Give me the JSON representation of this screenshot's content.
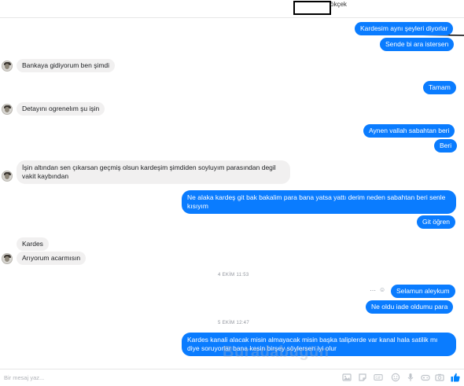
{
  "header": {
    "name_partial": "ökçek"
  },
  "messages": [
    {
      "id": "m1",
      "side": "out",
      "text": "Kardesim aynı şeyleri diyorlar"
    },
    {
      "id": "m2",
      "side": "out",
      "text": "Sende bi ara istersen"
    },
    {
      "id": "m3",
      "side": "in",
      "text": "Bankaya gidiyorum ben şimdi"
    },
    {
      "id": "m4",
      "side": "out",
      "text": "Tamam"
    },
    {
      "id": "m5",
      "side": "in",
      "text": "Detayını ogrenelım şu işin"
    },
    {
      "id": "m6",
      "side": "out",
      "text": "Aynen vallah sabahtan beri"
    },
    {
      "id": "m7",
      "side": "out",
      "text": "Beri"
    },
    {
      "id": "m8",
      "side": "in",
      "text": "İşin altından sen çıkarsan geçmiş olsun kardeşim şimdiden soyluyım parasından degil vakit kaybından"
    },
    {
      "id": "m9",
      "side": "out",
      "text": "Ne alaka kardeş git bak bakalim para bana yatsa yattı derim neden sabahtan beri senle kısıyım"
    },
    {
      "id": "m10",
      "side": "out",
      "text": "Git öğren"
    },
    {
      "id": "m11",
      "side": "in",
      "text": "Kardes"
    },
    {
      "id": "m12",
      "side": "in",
      "text": "Arıyorum acarmısın"
    },
    {
      "id": "m13",
      "side": "out",
      "text": "Selamun aleykum"
    },
    {
      "id": "m14",
      "side": "out",
      "text": "Ne oldu iade oldumu para"
    },
    {
      "id": "m15",
      "side": "out",
      "text": "Kardes kanali alacak misin almayacak misin başka taliplerde var kanal hala satilik mı diye soruyorlar bana kesin birşey söylersen iyi olur"
    }
  ],
  "timestamps": {
    "t1": "4 EKİM 11:53",
    "t2": "5 EKİM 12:47"
  },
  "composer": {
    "placeholder": "Bir mesaj yaz..."
  },
  "watermark": "Buradabugün",
  "colors": {
    "outgoing": "#0a7cff",
    "incoming": "#f1f0f0",
    "accent": "#0084ff"
  }
}
